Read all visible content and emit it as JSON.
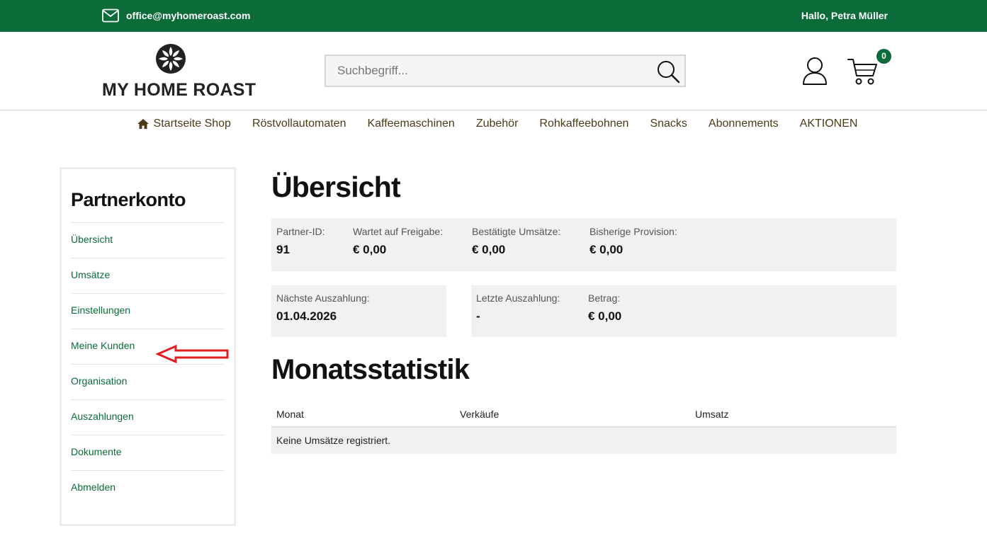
{
  "topbar": {
    "email": "office@myhomeroast.com",
    "greeting": "Hallo, Petra Müller",
    "icon": "mail-icon"
  },
  "header": {
    "logo_text": "MY HOME ROAST",
    "search_placeholder": "Suchbegriff...",
    "cart_count": "0",
    "icons": [
      "search-icon",
      "user-icon",
      "cart-icon"
    ]
  },
  "nav": {
    "items": [
      {
        "label": "Startseite Shop",
        "icon": "home-icon"
      },
      {
        "label": "Röstvollautomaten"
      },
      {
        "label": "Kaffeemaschinen"
      },
      {
        "label": "Zubehör"
      },
      {
        "label": "Rohkaffeebohnen"
      },
      {
        "label": "Snacks"
      },
      {
        "label": "Abonnements"
      },
      {
        "label": "AKTIONEN"
      }
    ]
  },
  "sidebar": {
    "title": "Partnerkonto",
    "items": [
      {
        "label": "Übersicht"
      },
      {
        "label": "Umsätze"
      },
      {
        "label": "Einstellungen"
      },
      {
        "label": "Meine Kunden"
      },
      {
        "label": "Organisation"
      },
      {
        "label": "Auszahlungen"
      },
      {
        "label": "Dokumente"
      },
      {
        "label": "Abmelden"
      }
    ]
  },
  "overview": {
    "title": "Übersicht",
    "stats": [
      {
        "label": "Partner-ID:",
        "value": "91"
      },
      {
        "label": "Wartet auf Freigabe:",
        "value": "€ 0,00"
      },
      {
        "label": "Bestätigte Umsätze:",
        "value": "€ 0,00"
      },
      {
        "label": "Bisherige Provision:",
        "value": "€ 0,00"
      }
    ],
    "next_payout": {
      "label": "Nächste Auszahlung:",
      "value": "01.04.2026"
    },
    "last_payout": {
      "label": "Letzte Auszahlung:",
      "value": "-"
    },
    "amount": {
      "label": "Betrag:",
      "value": "€ 0,00"
    }
  },
  "monthly": {
    "title": "Monatsstatistik",
    "columns": [
      "Monat",
      "Verkäufe",
      "Umsatz"
    ],
    "empty_text": "Keine Umsätze registriert."
  },
  "annotation": {
    "arrow_color": "#e02020"
  },
  "colors": {
    "brand_green": "#0b6b39",
    "nav_text": "#4a3c1a",
    "panel_bg": "#f1f1f1"
  }
}
